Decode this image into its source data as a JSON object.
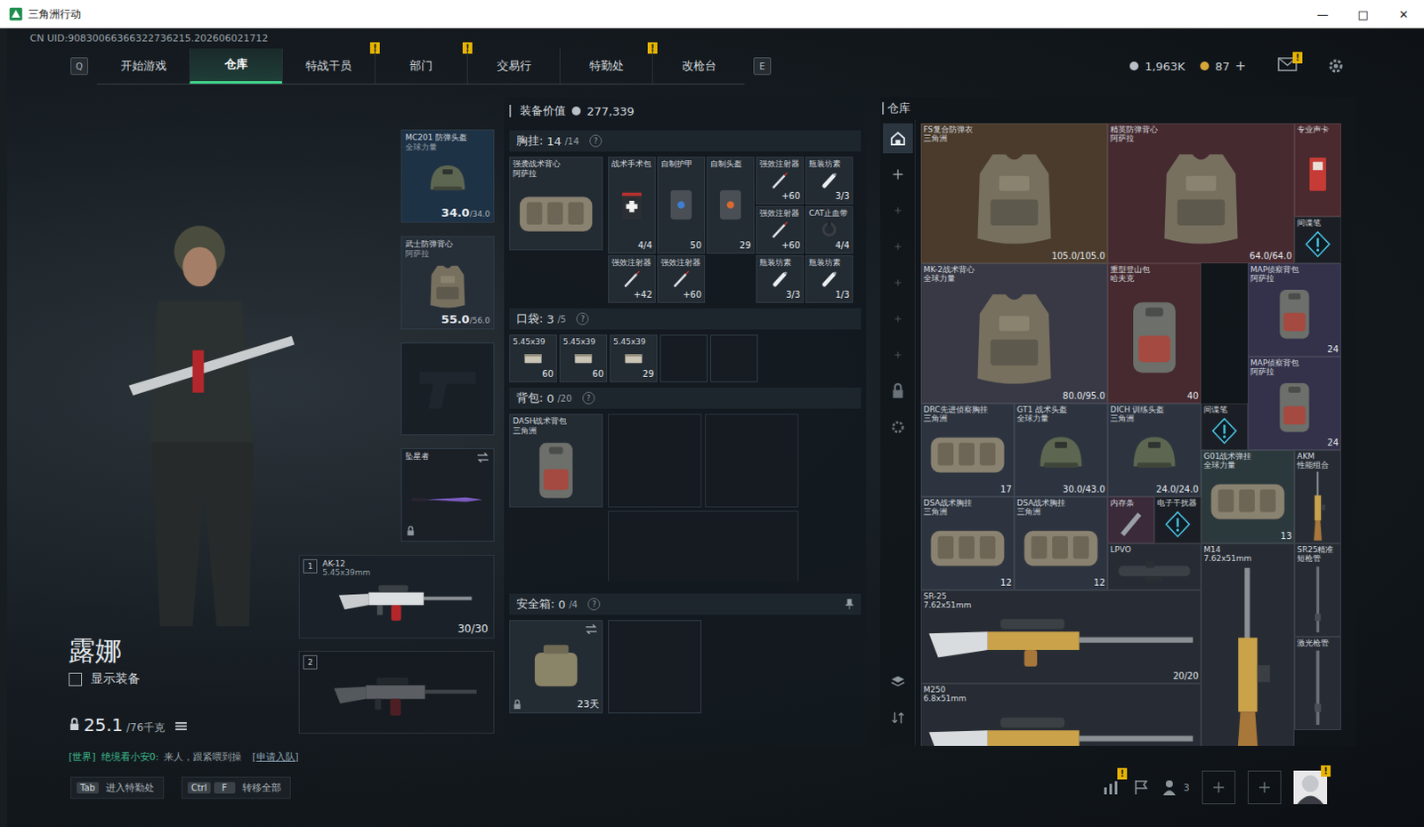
{
  "window": {
    "title": "三角洲行动",
    "controls": [
      "—",
      "□",
      "✕"
    ]
  },
  "uid": "CN UID:90830066366322736215.202606021712",
  "nav": {
    "prev_key": "Q",
    "next_key": "E",
    "alert_mark": "!",
    "tabs": [
      {
        "label": "开始游戏",
        "selected": false,
        "alert": false
      },
      {
        "label": "仓库",
        "selected": true,
        "alert": false
      },
      {
        "label": "特战干员",
        "selected": false,
        "alert": true
      },
      {
        "label": "部门",
        "selected": false,
        "alert": true
      },
      {
        "label": "交易行",
        "selected": false,
        "alert": false
      },
      {
        "label": "特勤处",
        "selected": false,
        "alert": true
      },
      {
        "label": "改枪台",
        "selected": false,
        "alert": false
      }
    ]
  },
  "currency": {
    "coins": "1,963K",
    "tickets": "87",
    "add": "+"
  },
  "mail": {
    "alert": "!"
  },
  "character": {
    "name": "露娜",
    "show_gear": {
      "label": "显示装备",
      "checked": false
    },
    "weight": "25.1",
    "weight_max": "/76千克"
  },
  "gear_slots": [
    {
      "name": "MC201 防弹头盔",
      "sub": "全球力量",
      "durability": "34.0",
      "durability_max": "/34.0",
      "kind": "helmet",
      "empty": false,
      "locked": false,
      "swap": false,
      "color": "#1e3246"
    },
    {
      "name": "武士防弹背心",
      "sub": "阿萨拉",
      "durability": "55.0",
      "durability_max": "/56.0",
      "kind": "armor",
      "empty": false,
      "locked": false,
      "swap": false,
      "color": "#262e38"
    },
    {
      "name": "",
      "sub": "",
      "durability": "",
      "durability_max": "",
      "kind": "pistol",
      "empty": true,
      "locked": false,
      "swap": false,
      "color": "#182026"
    },
    {
      "name": "坠星者",
      "sub": "",
      "durability": "",
      "durability_max": "",
      "kind": "knife",
      "empty": false,
      "locked": true,
      "swap": true,
      "color": "#1b2027"
    }
  ],
  "weapons": [
    {
      "index": "1",
      "name": "AK-12",
      "caliber": "5.45x39mm",
      "ammo": "30/30",
      "empty": false
    },
    {
      "index": "2",
      "name": "",
      "caliber": "",
      "ammo": "",
      "empty": true
    }
  ],
  "loadout": {
    "value_label": "装备价值",
    "value": "277,339",
    "help": "?",
    "chest": {
      "label": "胸挂:",
      "count": "14",
      "capacity": "/14",
      "rig": {
        "name": "强袭战术背心",
        "sub": "阿萨拉",
        "kind": "rig"
      },
      "items": [
        {
          "name": "战术手术包",
          "value": "4/4",
          "kind": "medkit"
        },
        {
          "name": "自制护甲",
          "value": "50",
          "kind": "armor-kit"
        },
        {
          "name": "自制头盔",
          "value": "29",
          "kind": "helmet-kit"
        },
        {
          "name": "强效注射器",
          "value": "+60",
          "kind": "syringe"
        },
        {
          "name": "瓶装坊素",
          "value": "3/3",
          "kind": "bottle"
        },
        {
          "name": "强效注射器",
          "value": "+60",
          "kind": "syringe"
        },
        {
          "name": "CAT止血带",
          "value": "4/4",
          "kind": "tourniquet"
        },
        {
          "name": "强效注射器",
          "value": "+42",
          "kind": "syringe"
        },
        {
          "name": "强效注射器",
          "value": "+60",
          "kind": "syringe"
        },
        {
          "name": "瓶装坊素",
          "value": "3/3",
          "kind": "bottle"
        },
        {
          "name": "瓶装坊素",
          "value": "1/3",
          "kind": "bottle"
        }
      ]
    },
    "pocket": {
      "label": "口袋:",
      "count": "3",
      "capacity": "/5",
      "slots": 5,
      "items": [
        {
          "name": "5.45x39",
          "value": "60",
          "kind": "ammo"
        },
        {
          "name": "5.45x39",
          "value": "60",
          "kind": "ammo"
        },
        {
          "name": "5.45x39",
          "value": "29",
          "kind": "ammo"
        }
      ]
    },
    "backpack": {
      "label": "背包:",
      "count": "0",
      "capacity": "/20",
      "bag": {
        "name": "DASH战术背包",
        "sub": "三角洲",
        "kind": "bag"
      }
    },
    "safe": {
      "label": "安全箱:",
      "count": "0",
      "capacity": "/4",
      "timer": "23天",
      "locked": true,
      "kind": "case"
    }
  },
  "warehouse": {
    "title": "仓库",
    "sidebar": [
      {
        "kind": "home",
        "selected": true
      },
      {
        "kind": "add",
        "selected": false
      },
      {
        "kind": "slot",
        "selected": false
      },
      {
        "kind": "slot",
        "selected": false
      },
      {
        "kind": "slot",
        "selected": false
      },
      {
        "kind": "slot",
        "selected": false
      },
      {
        "kind": "slot",
        "selected": false
      },
      {
        "kind": "lock",
        "selected": false
      },
      {
        "kind": "settings",
        "selected": false
      },
      {
        "kind": "layers",
        "selected": false
      },
      {
        "kind": "sort",
        "selected": false
      }
    ],
    "items": [
      {
        "name": "FS复合防弹衣",
        "sub": "三角洲",
        "value": "105.0/105.0",
        "kind": "armor",
        "color": "#4a3b2c"
      },
      {
        "name": "精英防弹背心",
        "sub": "阿萨拉",
        "value": "64.0/64.0",
        "kind": "armor",
        "color": "#452a30"
      },
      {
        "name": "专业声卡",
        "sub": "",
        "value": "",
        "kind": "card",
        "color": "#4a2a2e"
      },
      {
        "name": "间谍笔",
        "sub": "",
        "value": "",
        "kind": "intel",
        "color": "#1b1f25"
      },
      {
        "name": "MK-2战术背心",
        "sub": "全球力量",
        "value": "80.0/95.0",
        "kind": "armor",
        "color": "#383945"
      },
      {
        "name": "重型登山包",
        "sub": "哈夫克",
        "value": "40",
        "kind": "bag",
        "color": "#462a30"
      },
      {
        "name": "MAP侦察背包",
        "sub": "阿萨拉",
        "value": "24",
        "kind": "bag",
        "color": "#33324a"
      },
      {
        "name": "MAP侦察背包",
        "sub": "阿萨拉",
        "value": "24",
        "kind": "bag",
        "color": "#33324a"
      },
      {
        "name": "间谍笔",
        "sub": "",
        "value": "",
        "kind": "intel",
        "color": "#1b1f25"
      },
      {
        "name": "DRC先进侦察胸挂",
        "sub": "三角洲",
        "value": "17",
        "kind": "rig",
        "color": "#2d3440"
      },
      {
        "name": "GT1 战术头盔",
        "sub": "全球力量",
        "value": "30.0/43.0",
        "kind": "helmet",
        "color": "#2d3440"
      },
      {
        "name": "DICH 训练头盔",
        "sub": "三角洲",
        "value": "24.0/24.0",
        "kind": "helmet",
        "color": "#2d3440"
      },
      {
        "name": "G01战术弹挂",
        "sub": "全球力量",
        "value": "13",
        "kind": "rig",
        "color": "#2b393d"
      },
      {
        "name": "AKM",
        "sub": "性能组合",
        "value": "",
        "kind": "rifle-v",
        "color": "#272c34"
      },
      {
        "name": "DSA战术胸挂",
        "sub": "三角洲",
        "value": "12",
        "kind": "rig",
        "color": "#2d3440"
      },
      {
        "name": "DSA战术胸挂",
        "sub": "三角洲",
        "value": "12",
        "kind": "rig",
        "color": "#2d3440"
      },
      {
        "name": "内存条",
        "sub": "",
        "value": "",
        "kind": "chip",
        "color": "#3a2a3a"
      },
      {
        "name": "电子干扰器",
        "sub": "",
        "value": "",
        "kind": "intel",
        "color": "#1b1f25"
      },
      {
        "name": "LPVO",
        "sub": "",
        "value": "",
        "kind": "scope",
        "color": "#272c34"
      },
      {
        "name": "M14",
        "sub": "7.62x51mm",
        "value": "",
        "kind": "rifle-v",
        "color": "#272c34"
      },
      {
        "name": "SR25精准短枪管",
        "sub": "",
        "value": "",
        "kind": "part-v",
        "color": "#272c34"
      },
      {
        "name": "激光枪管",
        "sub": "",
        "value": "",
        "kind": "part-v",
        "color": "#272c34"
      },
      {
        "name": "SR-25",
        "sub": "7.62x51mm",
        "value": "20/20",
        "kind": "sniper",
        "color": "#272c34"
      },
      {
        "name": "M250",
        "sub": "6.8x51mm",
        "value": "",
        "kind": "sniper",
        "color": "#272c34"
      }
    ]
  },
  "chat": {
    "channel": "[世界]",
    "sender": "绝境看小安0:",
    "message": "来人，跟紧喂到操",
    "action": "[申请入队]"
  },
  "hints": [
    {
      "keys": [
        "Tab"
      ],
      "label": "进入特勤处"
    },
    {
      "keys": [
        "Ctrl",
        "F"
      ],
      "label": "转移全部"
    }
  ],
  "social": {
    "stats_alert": "!",
    "friends": "3",
    "avatar_alert": "!"
  }
}
